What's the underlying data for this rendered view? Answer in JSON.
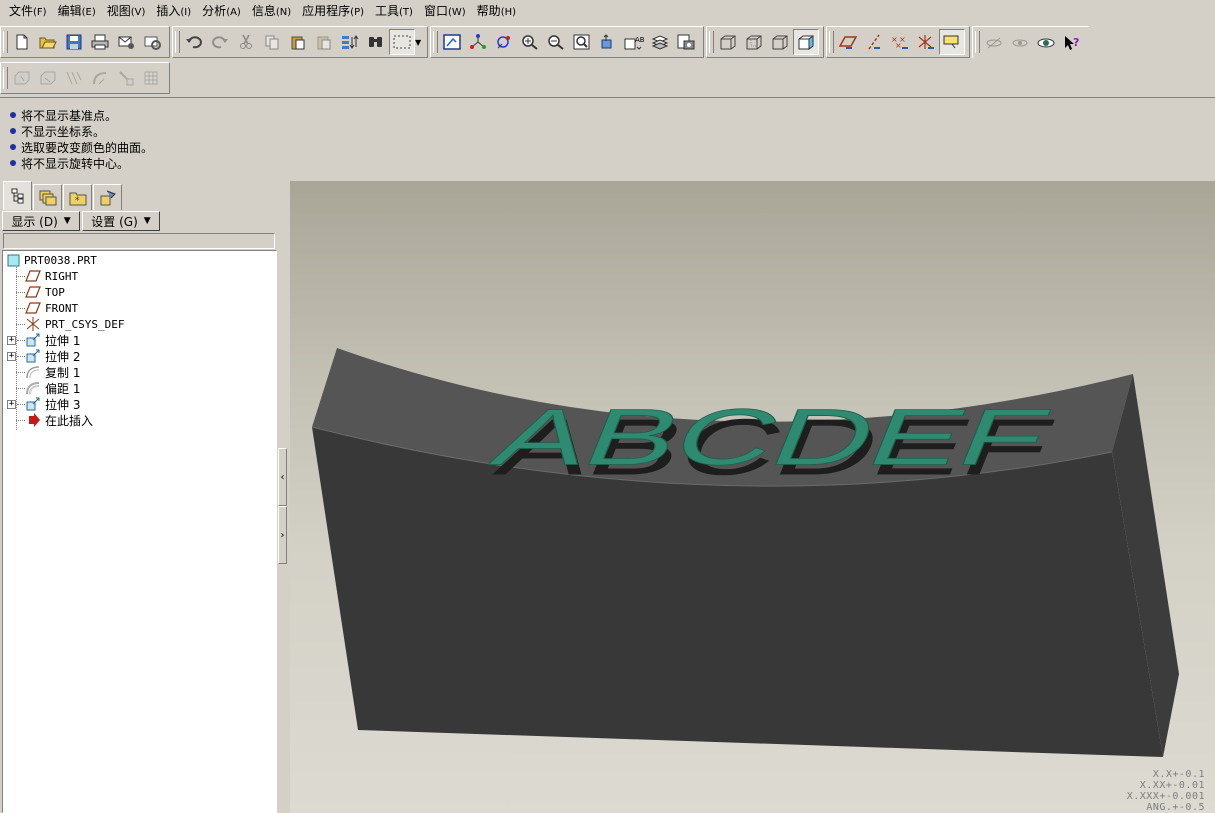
{
  "menu": [
    {
      "label": "文件",
      "accel": "(F)"
    },
    {
      "label": "编辑",
      "accel": "(E)"
    },
    {
      "label": "视图",
      "accel": "(V)"
    },
    {
      "label": "插入",
      "accel": "(I)"
    },
    {
      "label": "分析",
      "accel": "(A)"
    },
    {
      "label": "信息",
      "accel": "(N)"
    },
    {
      "label": "应用程序",
      "accel": "(P)"
    },
    {
      "label": "工具",
      "accel": "(T)"
    },
    {
      "label": "窗口",
      "accel": "(W)"
    },
    {
      "label": "帮助",
      "accel": "(H)"
    }
  ],
  "messages": [
    "将不显示基准点。",
    "不显示坐标系。",
    "选取要改变颜色的曲面。",
    "将不显示旋转中心。"
  ],
  "navigator": {
    "show_button": "显示 (D)",
    "settings_button": "设置 (G)",
    "tabs": [
      "model-tree-icon",
      "layers-icon",
      "folder-browser-icon",
      "favorites-icon"
    ]
  },
  "tree": {
    "root": "PRT0038.PRT",
    "items": [
      {
        "label": "RIGHT",
        "icon": "datum-plane-icon",
        "expandable": false
      },
      {
        "label": "TOP",
        "icon": "datum-plane-icon",
        "expandable": false
      },
      {
        "label": "FRONT",
        "icon": "datum-plane-icon",
        "expandable": false
      },
      {
        "label": "PRT_CSYS_DEF",
        "icon": "csys-icon",
        "expandable": false
      },
      {
        "label": "拉伸 1",
        "icon": "extrude-icon",
        "expandable": true
      },
      {
        "label": "拉伸 2",
        "icon": "extrude-icon",
        "expandable": true
      },
      {
        "label": "复制 1",
        "icon": "copy-surface-icon",
        "expandable": false
      },
      {
        "label": "偏距 1",
        "icon": "offset-icon",
        "expandable": false
      },
      {
        "label": "拉伸 3",
        "icon": "extrude-icon",
        "expandable": true
      },
      {
        "label": "在此插入",
        "icon": "insert-here-icon",
        "expandable": false
      }
    ]
  },
  "model": {
    "text": "ABCDEF",
    "body_color": "#4a4a4a",
    "text_color": "#2e8a70"
  },
  "tolerances": [
    "X.X+-0.1",
    "X.XX+-0.01",
    "X.XXX+-0.001",
    "ANG.+-0.5"
  ]
}
